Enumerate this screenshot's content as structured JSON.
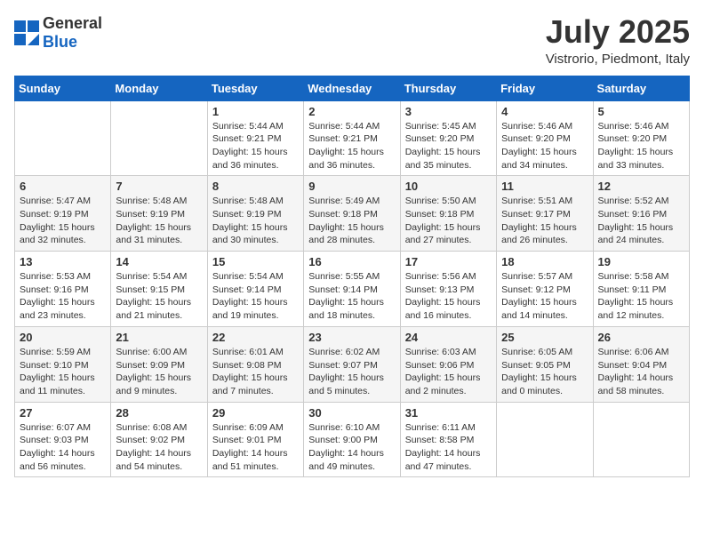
{
  "header": {
    "logo_general": "General",
    "logo_blue": "Blue",
    "month": "July 2025",
    "location": "Vistrorio, Piedmont, Italy"
  },
  "weekdays": [
    "Sunday",
    "Monday",
    "Tuesday",
    "Wednesday",
    "Thursday",
    "Friday",
    "Saturday"
  ],
  "weeks": [
    [
      {
        "day": "",
        "content": ""
      },
      {
        "day": "",
        "content": ""
      },
      {
        "day": "1",
        "content": "Sunrise: 5:44 AM\nSunset: 9:21 PM\nDaylight: 15 hours and 36 minutes."
      },
      {
        "day": "2",
        "content": "Sunrise: 5:44 AM\nSunset: 9:21 PM\nDaylight: 15 hours and 36 minutes."
      },
      {
        "day": "3",
        "content": "Sunrise: 5:45 AM\nSunset: 9:20 PM\nDaylight: 15 hours and 35 minutes."
      },
      {
        "day": "4",
        "content": "Sunrise: 5:46 AM\nSunset: 9:20 PM\nDaylight: 15 hours and 34 minutes."
      },
      {
        "day": "5",
        "content": "Sunrise: 5:46 AM\nSunset: 9:20 PM\nDaylight: 15 hours and 33 minutes."
      }
    ],
    [
      {
        "day": "6",
        "content": "Sunrise: 5:47 AM\nSunset: 9:19 PM\nDaylight: 15 hours and 32 minutes."
      },
      {
        "day": "7",
        "content": "Sunrise: 5:48 AM\nSunset: 9:19 PM\nDaylight: 15 hours and 31 minutes."
      },
      {
        "day": "8",
        "content": "Sunrise: 5:48 AM\nSunset: 9:19 PM\nDaylight: 15 hours and 30 minutes."
      },
      {
        "day": "9",
        "content": "Sunrise: 5:49 AM\nSunset: 9:18 PM\nDaylight: 15 hours and 28 minutes."
      },
      {
        "day": "10",
        "content": "Sunrise: 5:50 AM\nSunset: 9:18 PM\nDaylight: 15 hours and 27 minutes."
      },
      {
        "day": "11",
        "content": "Sunrise: 5:51 AM\nSunset: 9:17 PM\nDaylight: 15 hours and 26 minutes."
      },
      {
        "day": "12",
        "content": "Sunrise: 5:52 AM\nSunset: 9:16 PM\nDaylight: 15 hours and 24 minutes."
      }
    ],
    [
      {
        "day": "13",
        "content": "Sunrise: 5:53 AM\nSunset: 9:16 PM\nDaylight: 15 hours and 23 minutes."
      },
      {
        "day": "14",
        "content": "Sunrise: 5:54 AM\nSunset: 9:15 PM\nDaylight: 15 hours and 21 minutes."
      },
      {
        "day": "15",
        "content": "Sunrise: 5:54 AM\nSunset: 9:14 PM\nDaylight: 15 hours and 19 minutes."
      },
      {
        "day": "16",
        "content": "Sunrise: 5:55 AM\nSunset: 9:14 PM\nDaylight: 15 hours and 18 minutes."
      },
      {
        "day": "17",
        "content": "Sunrise: 5:56 AM\nSunset: 9:13 PM\nDaylight: 15 hours and 16 minutes."
      },
      {
        "day": "18",
        "content": "Sunrise: 5:57 AM\nSunset: 9:12 PM\nDaylight: 15 hours and 14 minutes."
      },
      {
        "day": "19",
        "content": "Sunrise: 5:58 AM\nSunset: 9:11 PM\nDaylight: 15 hours and 12 minutes."
      }
    ],
    [
      {
        "day": "20",
        "content": "Sunrise: 5:59 AM\nSunset: 9:10 PM\nDaylight: 15 hours and 11 minutes."
      },
      {
        "day": "21",
        "content": "Sunrise: 6:00 AM\nSunset: 9:09 PM\nDaylight: 15 hours and 9 minutes."
      },
      {
        "day": "22",
        "content": "Sunrise: 6:01 AM\nSunset: 9:08 PM\nDaylight: 15 hours and 7 minutes."
      },
      {
        "day": "23",
        "content": "Sunrise: 6:02 AM\nSunset: 9:07 PM\nDaylight: 15 hours and 5 minutes."
      },
      {
        "day": "24",
        "content": "Sunrise: 6:03 AM\nSunset: 9:06 PM\nDaylight: 15 hours and 2 minutes."
      },
      {
        "day": "25",
        "content": "Sunrise: 6:05 AM\nSunset: 9:05 PM\nDaylight: 15 hours and 0 minutes."
      },
      {
        "day": "26",
        "content": "Sunrise: 6:06 AM\nSunset: 9:04 PM\nDaylight: 14 hours and 58 minutes."
      }
    ],
    [
      {
        "day": "27",
        "content": "Sunrise: 6:07 AM\nSunset: 9:03 PM\nDaylight: 14 hours and 56 minutes."
      },
      {
        "day": "28",
        "content": "Sunrise: 6:08 AM\nSunset: 9:02 PM\nDaylight: 14 hours and 54 minutes."
      },
      {
        "day": "29",
        "content": "Sunrise: 6:09 AM\nSunset: 9:01 PM\nDaylight: 14 hours and 51 minutes."
      },
      {
        "day": "30",
        "content": "Sunrise: 6:10 AM\nSunset: 9:00 PM\nDaylight: 14 hours and 49 minutes."
      },
      {
        "day": "31",
        "content": "Sunrise: 6:11 AM\nSunset: 8:58 PM\nDaylight: 14 hours and 47 minutes."
      },
      {
        "day": "",
        "content": ""
      },
      {
        "day": "",
        "content": ""
      }
    ]
  ]
}
